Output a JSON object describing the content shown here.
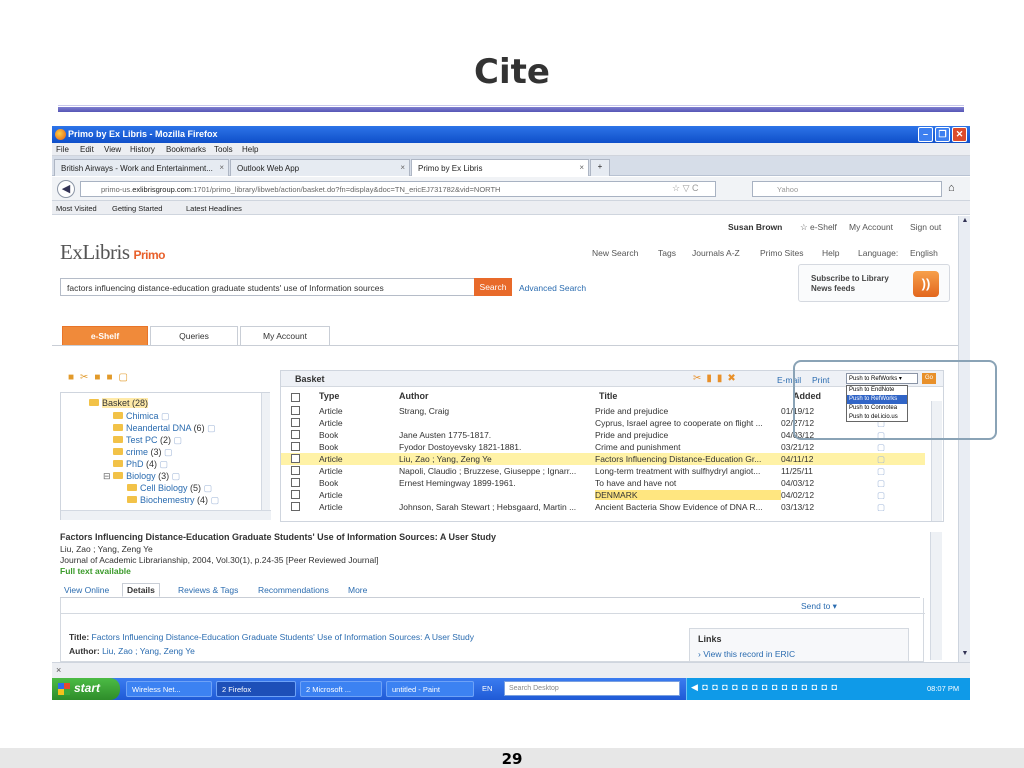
{
  "slide": {
    "title": "Cite",
    "page_number": "29"
  },
  "window": {
    "title": "Primo by Ex Libris - Mozilla Firefox",
    "menu": [
      "File",
      "Edit",
      "View",
      "History",
      "Bookmarks",
      "Tools",
      "Help"
    ],
    "tabs": [
      "British Airways - Work and Entertainment...",
      "Outlook Web App",
      "Primo by Ex Libris"
    ],
    "url_prefix": "primo-us.",
    "url_domain": "exlibrisgroup.com",
    "url_rest": ":1701/primo_library/libweb/action/basket.do?fn=display&doc=TN_ericEJ731782&vid=NORTH",
    "search_engine": "Yahoo",
    "bookmarks": [
      "Most Visited",
      "Getting Started",
      "Latest Headlines"
    ]
  },
  "primo": {
    "user_name": "Susan Brown",
    "user_links": [
      "e-Shelf",
      "My Account",
      "Sign out"
    ],
    "logo_main": "ExLibris",
    "logo_sub": "Primo",
    "top_links": [
      "New Search",
      "Tags",
      "Journals A-Z",
      "Primo Sites",
      "Help",
      "Language:",
      "English"
    ],
    "subscribe": "Subscribe to Library News feeds",
    "query": "factors influencing distance-education graduate students' use of Information sources",
    "search_button": "Search",
    "advanced_search": "Advanced Search",
    "page_tabs": [
      "e-Shelf",
      "Queries",
      "My Account"
    ]
  },
  "folders": {
    "root": "Basket (28)",
    "items": [
      {
        "name": "Chimica",
        "count": ""
      },
      {
        "name": "Neandertal DNA",
        "count": "(6)"
      },
      {
        "name": "Test PC",
        "count": "(2)"
      },
      {
        "name": "crime",
        "count": "(3)"
      },
      {
        "name": "PhD",
        "count": "(4)"
      },
      {
        "name": "Biology",
        "count": "(3)"
      },
      {
        "name": "Cell Biology",
        "count": "(5)"
      },
      {
        "name": "Biochemestry",
        "count": "(4)"
      }
    ]
  },
  "basket": {
    "label": "Basket",
    "email": "E-mail",
    "print": "Print",
    "push_selected": "Push to RefWorks",
    "go": "Go",
    "push_options": [
      "Push to EndNote",
      "Push to RefWorks",
      "Push to Connotea",
      "Push to del.icio.us"
    ],
    "columns": [
      "Type",
      "Author",
      "Title",
      "Added"
    ],
    "rows": [
      {
        "type": "Article",
        "author": "Strang, Craig",
        "title": "Pride and prejudice",
        "added": "01/19/12"
      },
      {
        "type": "Article",
        "author": "",
        "title": "Cyprus, Israel agree to cooperate on flight ...",
        "added": "02/27/12"
      },
      {
        "type": "Book",
        "author": "Jane Austen 1775-1817.",
        "title": "Pride and prejudice",
        "added": "04/03/12"
      },
      {
        "type": "Book",
        "author": "Fyodor Dostoyevsky 1821-1881.",
        "title": "Crime and punishment",
        "added": "03/21/12"
      },
      {
        "type": "Article",
        "author": "Liu, Zao ; Yang, Zeng Ye",
        "title": "Factors Influencing Distance-Education Gr...",
        "added": "04/11/12"
      },
      {
        "type": "Article",
        "author": "Napoli, Claudio ; Bruzzese, Giuseppe ; Ignarr...",
        "title": "Long-term treatment with sulfhydryl angiot...",
        "added": "11/25/11"
      },
      {
        "type": "Book",
        "author": "Ernest Hemingway 1899-1961.",
        "title": "To have and have not",
        "added": "04/03/12"
      },
      {
        "type": "Article",
        "author": "",
        "title": "DENMARK",
        "added": "04/02/12"
      },
      {
        "type": "Article",
        "author": "Johnson, Sarah Stewart ; Hebsgaard, Martin ...",
        "title": "Ancient Bacteria Show Evidence of DNA R...",
        "added": "03/13/12"
      }
    ]
  },
  "detail": {
    "title": "Factors Influencing Distance-Education Graduate Students' Use of Information Sources: A User Study",
    "authors": "Liu, Zao ; Yang, Zeng Ye",
    "source": "Journal of Academic Librarianship, 2004, Vol.30(1), p.24-35 [Peer Reviewed Journal]",
    "full_text": "Full text available",
    "tabs": [
      "View Online",
      "Details",
      "Reviews & Tags",
      "Recommendations",
      "More"
    ],
    "send_to": "Send to",
    "title_label": "Title:",
    "title_value": "Factors Influencing Distance-Education Graduate Students' Use of Information Sources: A User Study",
    "author_label": "Author:",
    "author_value": "Liu, Zao ; Yang, Zeng Ye",
    "links_head": "Links",
    "links_item": "View this record in ERIC"
  },
  "taskbar": {
    "start": "start",
    "tasks": [
      "Wireless Net...",
      "2 Firefox",
      "2 Microsoft ...",
      "untitled - Paint"
    ],
    "lang": "EN",
    "desktop_search": "Search Desktop",
    "clock": "08:07 PM"
  }
}
